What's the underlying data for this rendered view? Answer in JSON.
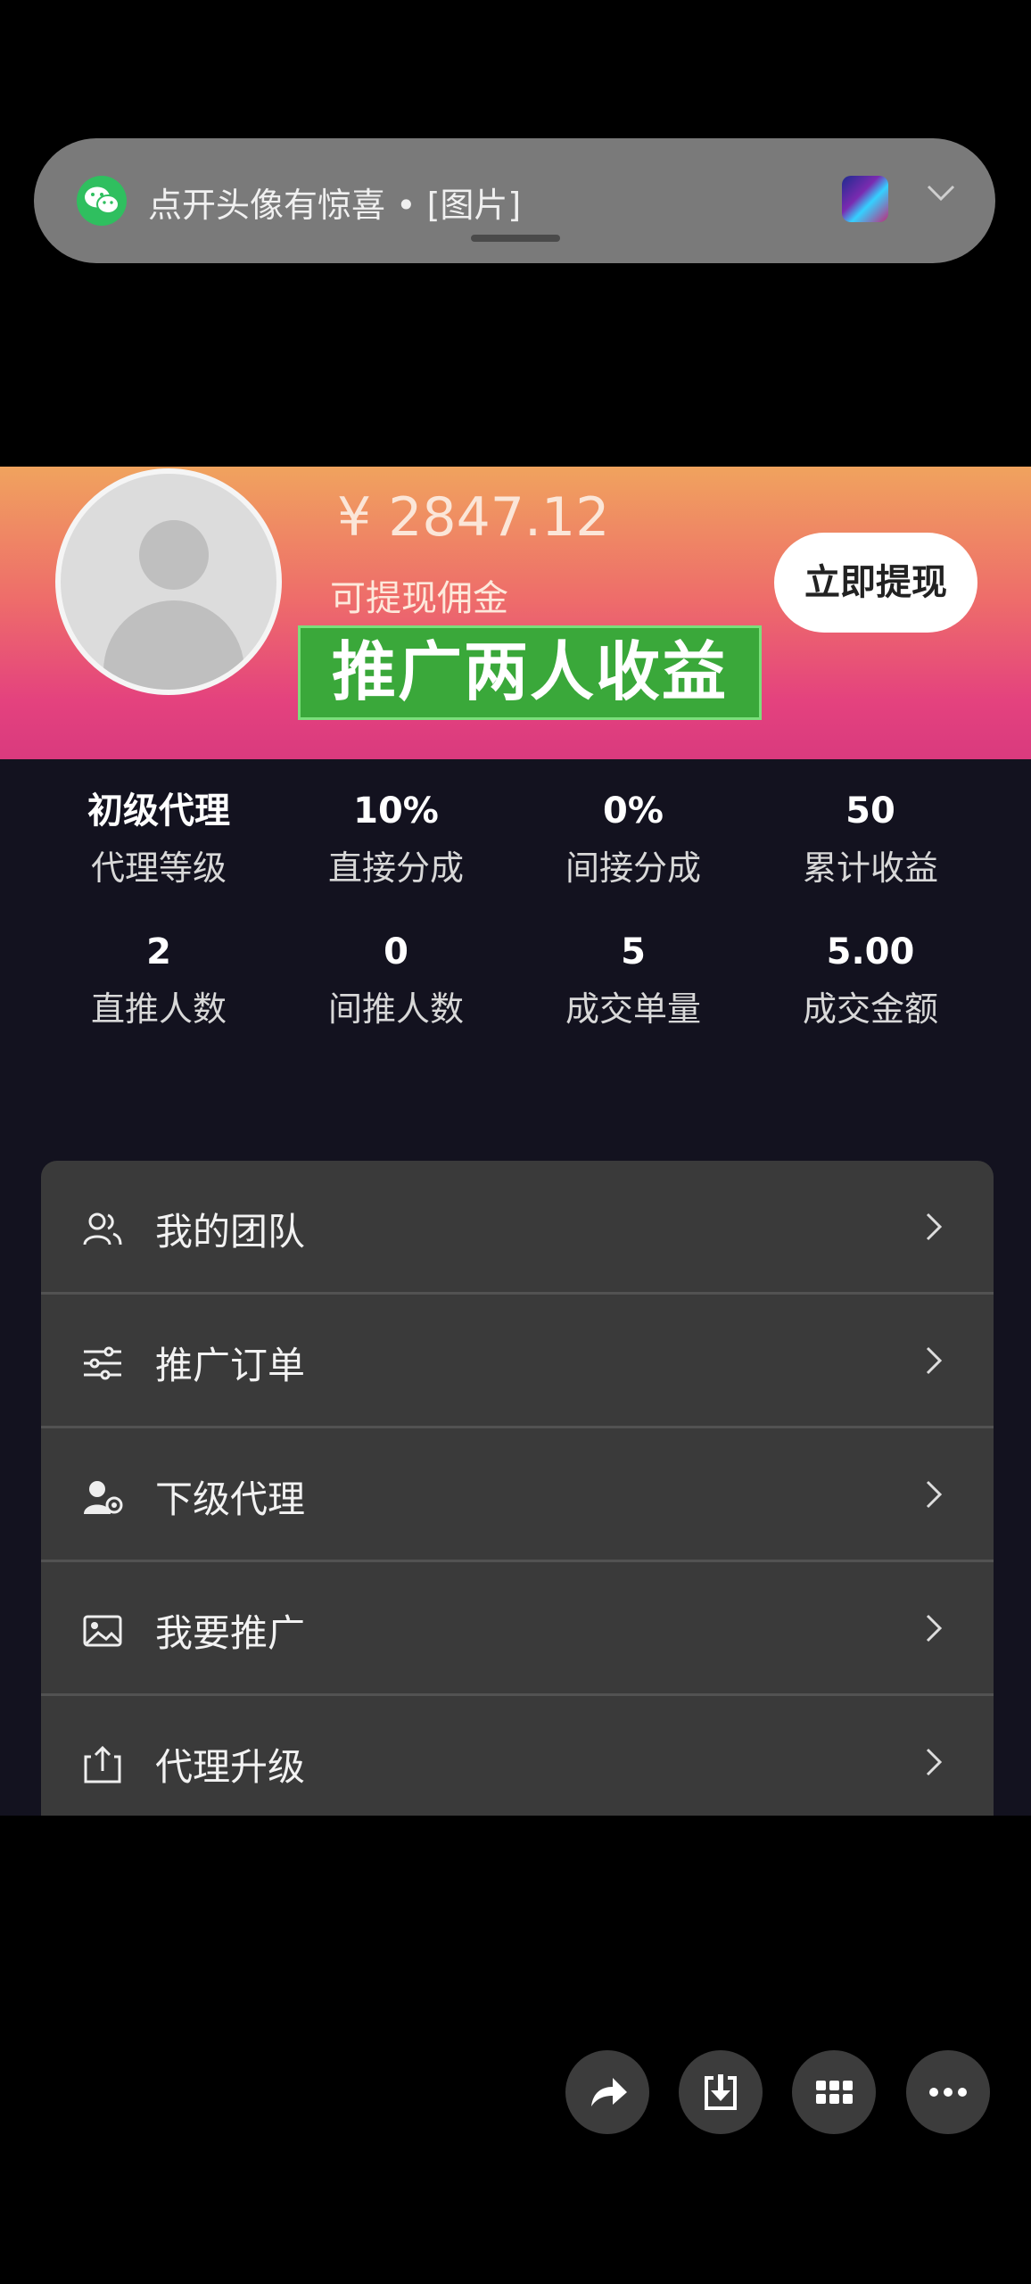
{
  "notification": {
    "message": "点开头像有惊喜 • [图片]",
    "app_icon": "wechat-icon",
    "colors": {
      "background": "#7a7a7a",
      "wechat_green": "#2fbf5f"
    }
  },
  "header": {
    "amount": "¥ 2847.12",
    "amount_label": "可提现佣金",
    "withdraw_button": "立即提现",
    "promo_overlay": "推广两人收益",
    "colors": {
      "gradient_top": "#f0a35e",
      "gradient_bottom": "#d93a7e",
      "promo_green": "#3aa83a"
    }
  },
  "stats": [
    {
      "value": "初级代理",
      "label": "代理等级"
    },
    {
      "value": "10%",
      "label": "直接分成"
    },
    {
      "value": "0%",
      "label": "间接分成"
    },
    {
      "value": "50",
      "label": "累计收益"
    },
    {
      "value": "2",
      "label": "直推人数"
    },
    {
      "value": "0",
      "label": "间推人数"
    },
    {
      "value": "5",
      "label": "成交单量"
    },
    {
      "value": "5.00",
      "label": "成交金额"
    }
  ],
  "menu": [
    {
      "label": "我的团队",
      "icon": "team-icon"
    },
    {
      "label": "推广订单",
      "icon": "sliders-icon"
    },
    {
      "label": "下级代理",
      "icon": "sub-agent-icon"
    },
    {
      "label": "我要推广",
      "icon": "image-icon"
    },
    {
      "label": "代理升级",
      "icon": "upload-icon"
    }
  ],
  "actions": [
    {
      "name": "share",
      "icon": "share-icon"
    },
    {
      "name": "download",
      "icon": "download-icon"
    },
    {
      "name": "apps",
      "icon": "grid-icon"
    },
    {
      "name": "more",
      "icon": "more-icon"
    }
  ]
}
